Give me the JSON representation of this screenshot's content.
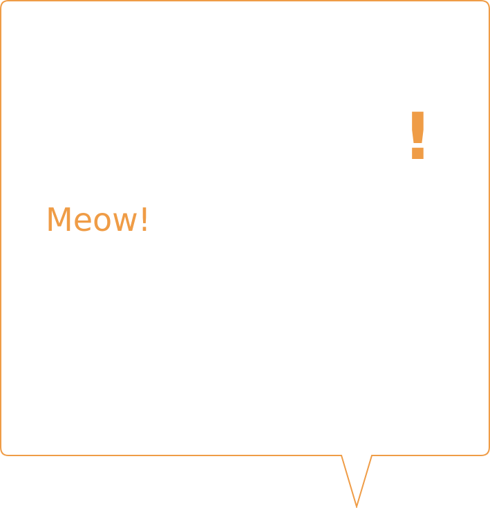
{
  "bubble": {
    "text": "Meow!",
    "exclamation": "!",
    "color": "#ef9c46",
    "background": "#ffffff"
  }
}
